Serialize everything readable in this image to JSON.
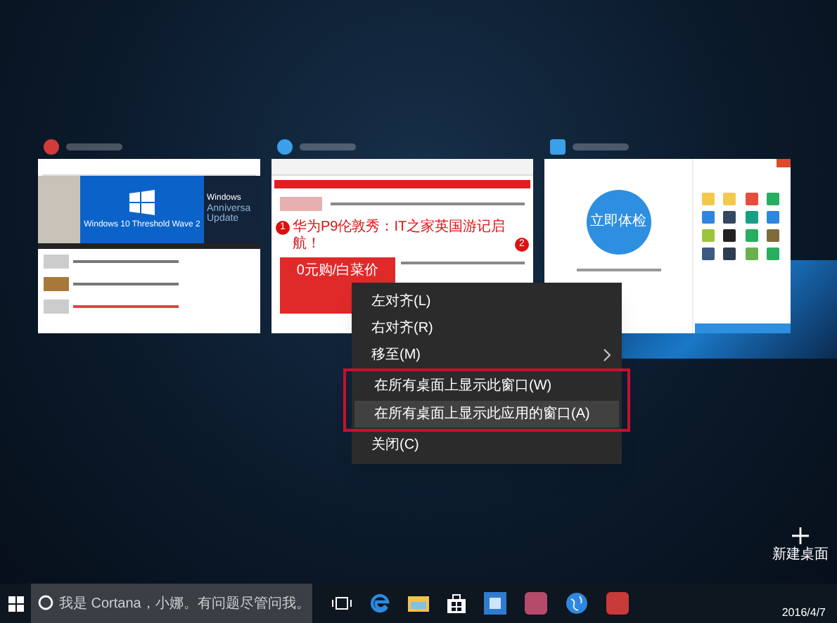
{
  "windows": [
    {
      "kind": "article",
      "hero_title": "Windows 10 Threshold Wave 2",
      "side_lines": [
        "Windows",
        "Anniversa",
        "Update"
      ]
    },
    {
      "kind": "portal",
      "badges": [
        "1",
        "2"
      ],
      "headline": "华为P9伦敦秀：IT之家英国游记启航！",
      "promo": "0元购/白菜价"
    },
    {
      "kind": "security",
      "scan_button": "立即体检"
    }
  ],
  "context_menu": {
    "items": [
      {
        "label": "左对齐(L)",
        "kind": "item",
        "selected": false,
        "marked": false
      },
      {
        "label": "右对齐(R)",
        "kind": "item",
        "selected": false,
        "marked": false
      },
      {
        "label": "移至(M)",
        "kind": "submenu",
        "selected": false,
        "marked": false
      },
      {
        "label": "在所有桌面上显示此窗口(W)",
        "kind": "item",
        "selected": false,
        "marked": true
      },
      {
        "label": "在所有桌面上显示此应用的窗口(A)",
        "kind": "item",
        "selected": true,
        "marked": true
      },
      {
        "label": "关闭(C)",
        "kind": "item",
        "selected": false,
        "marked": false
      }
    ]
  },
  "new_desktop": {
    "label": "新建桌面"
  },
  "taskbar": {
    "search": {
      "placeholder": "我是 Cortana，小娜。有问题尽管问我。"
    },
    "apps": [
      {
        "kind": "task-view"
      },
      {
        "kind": "edge"
      },
      {
        "kind": "explorer"
      },
      {
        "kind": "store"
      },
      {
        "kind": "mail"
      },
      {
        "kind": "pink-app"
      },
      {
        "kind": "globe"
      },
      {
        "kind": "red-app"
      }
    ],
    "date": "2016/4/7"
  }
}
